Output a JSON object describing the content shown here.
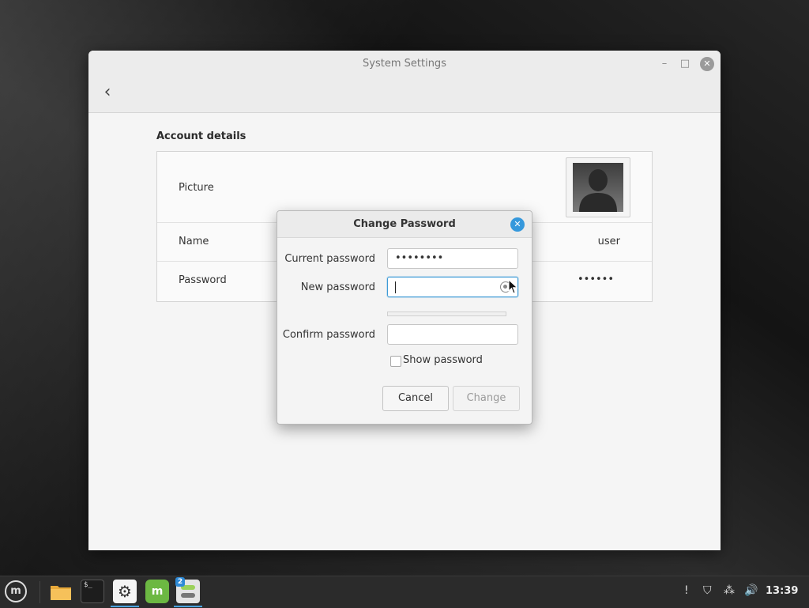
{
  "window": {
    "title": "System Settings",
    "controls": {
      "minimize": "–",
      "maximize": "□",
      "close": "✕"
    },
    "back_glyph": "‹"
  },
  "account": {
    "section_title": "Account details",
    "rows": [
      {
        "label": "Picture",
        "value": ""
      },
      {
        "label": "Name",
        "value": "user"
      },
      {
        "label": "Password",
        "value": "••••••"
      }
    ]
  },
  "dialog": {
    "title": "Change Password",
    "close_glyph": "✕",
    "current_password": {
      "label": "Current password",
      "value": "••••••••"
    },
    "new_password": {
      "label": "New password",
      "value": ""
    },
    "confirm_password": {
      "label": "Confirm password",
      "value": ""
    },
    "show_password": {
      "label": "Show password",
      "checked": false
    },
    "buttons": {
      "cancel": "Cancel",
      "change": "Change"
    }
  },
  "taskbar": {
    "menu_glyph": "m",
    "terminal_glyph": "$_",
    "settings_glyph": "⚙",
    "mint_glyph": "m",
    "workspace_badge": "2",
    "tray": {
      "clipboard": "!",
      "shield": "⛉",
      "network": "⁂",
      "volume": "🔊"
    },
    "clock": "13:39"
  },
  "colors": {
    "accent": "#3598dc",
    "taskbar": "#2b2b2b",
    "window_bg": "#f5f5f5"
  }
}
